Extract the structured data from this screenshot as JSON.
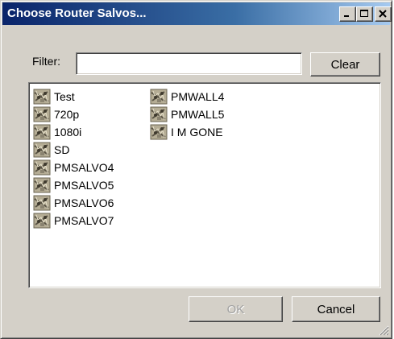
{
  "window": {
    "title": "Choose Router Salvos..."
  },
  "filter": {
    "label": "Filter:",
    "value": "",
    "clear_label": "Clear"
  },
  "salvos": {
    "column1": [
      "Test",
      "720p",
      "1080i",
      "SD",
      "PMSALVO4",
      "PMSALVO5",
      "PMSALVO6",
      "PMSALVO7"
    ],
    "column2": [
      "PMWALL4",
      "PMWALL5",
      "I M GONE"
    ]
  },
  "icons": {
    "titlebar_buttons": [
      "minimize-icon",
      "maximize-icon",
      "close-icon"
    ],
    "list_item": "salvo-icon",
    "resize": "resize-grip-icon"
  },
  "footer": {
    "ok_label": "OK",
    "cancel_label": "Cancel",
    "ok_disabled": true
  },
  "colors": {
    "titlebar_start": "#0a246a",
    "titlebar_end": "#a6caf0",
    "face": "#d4d0c8"
  }
}
